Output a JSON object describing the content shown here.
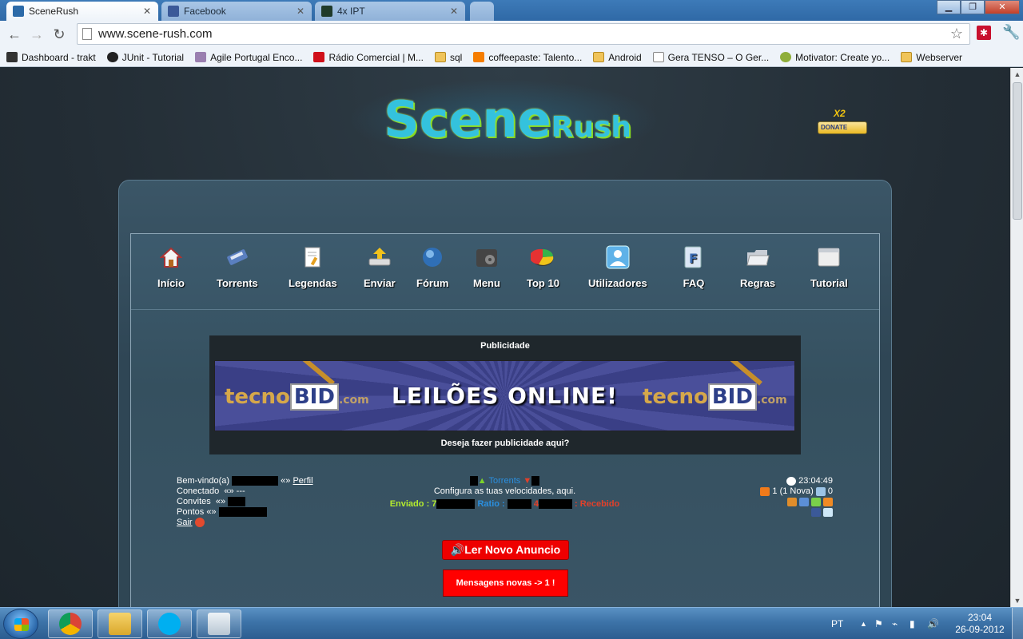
{
  "browser": {
    "tabs": [
      {
        "title": "SceneRush",
        "active": true
      },
      {
        "title": "Facebook",
        "active": false
      },
      {
        "title": "4x IPT",
        "active": false
      }
    ],
    "url": "www.scene-rush.com",
    "bookmarks": [
      {
        "label": "Dashboard - trakt"
      },
      {
        "label": "JUnit - Tutorial"
      },
      {
        "label": "Agile Portugal Enco..."
      },
      {
        "label": "Rádio Comercial | M..."
      },
      {
        "label": "sql"
      },
      {
        "label": "coffeepaste: Talento..."
      },
      {
        "label": "Android"
      },
      {
        "label": "Gera TENSO – O Ger..."
      },
      {
        "label": "Motivator: Create yo..."
      },
      {
        "label": "Webserver"
      }
    ]
  },
  "site": {
    "logo_part1": "Scene",
    "logo_part2": "Rush",
    "donate": {
      "badge": "X2",
      "label": "DONATE"
    },
    "nav": [
      {
        "label": "Início"
      },
      {
        "label": "Torrents"
      },
      {
        "label": "Legendas"
      },
      {
        "label": "Enviar"
      },
      {
        "label": "Fórum"
      },
      {
        "label": "Menu"
      },
      {
        "label": "Top 10"
      },
      {
        "label": "Utilizadores"
      },
      {
        "label": "FAQ"
      },
      {
        "label": "Regras"
      },
      {
        "label": "Tutorial"
      }
    ],
    "ad": {
      "title": "Publicidade",
      "banner_text": "LEILÕES ONLINE!",
      "brand": "tecno",
      "brand_bid": "BID",
      "brand_tld": ".com",
      "footer": "Deseja fazer publicidade aqui?"
    },
    "user": {
      "welcome": "Bem-vindo(a)",
      "sep": "«»",
      "profile_link": "Perfil",
      "connected_label": "Conectado",
      "connected_value": "---",
      "invites_label": "Convites",
      "points_label": "Pontos",
      "logout": "Sair"
    },
    "stats": {
      "torrents": "Torrents",
      "speed_text": "Configura as tuas velocidades, aqui.",
      "sent_label": "Enviado",
      "sent_prefix": "7",
      "ratio_label": "Ratio",
      "received_prefix": "4",
      "received_label": "Recebido"
    },
    "right": {
      "time": "23:04:49",
      "messages": "1 (1 Nova)",
      "unread": "0"
    },
    "buttons": {
      "announce": "Ler Novo Anuncio",
      "new_messages": "Mensagens novas -> 1 !"
    }
  },
  "taskbar": {
    "lang": "PT",
    "time": "23:04",
    "date": "26-09-2012"
  }
}
